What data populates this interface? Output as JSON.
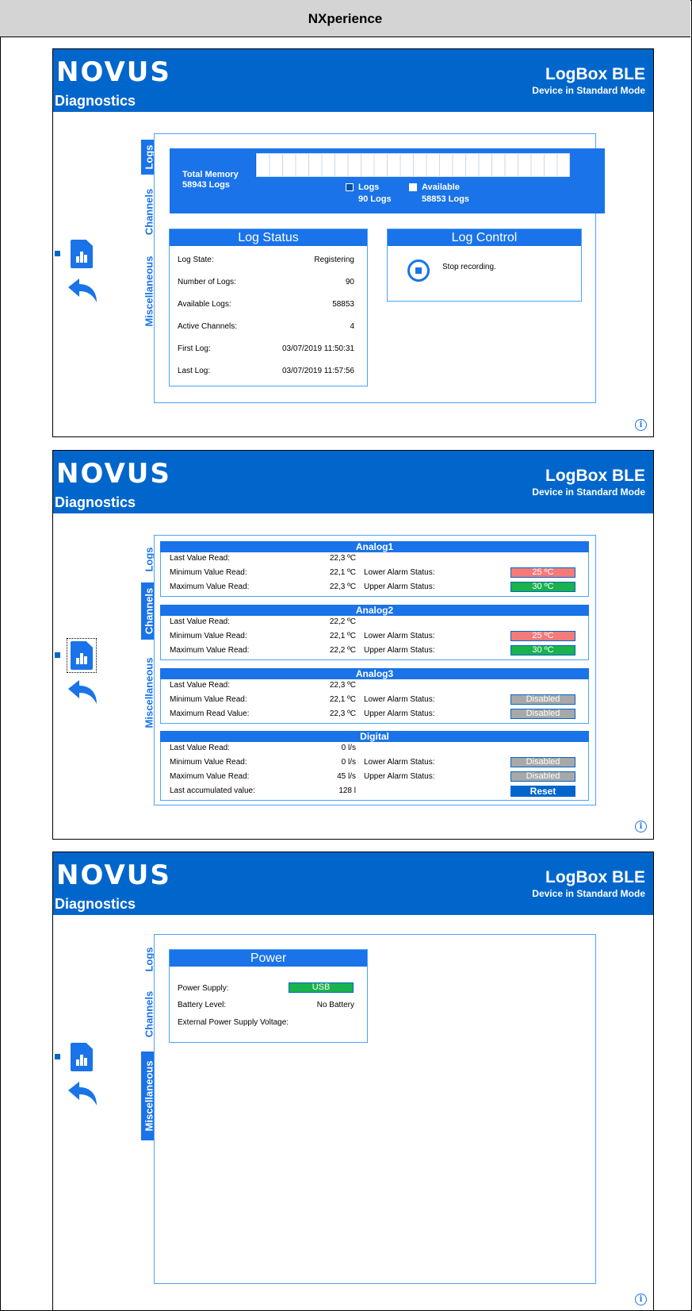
{
  "header": {
    "title": "NXperience"
  },
  "app": {
    "logo": "NOVUS",
    "section": "Diagnostics",
    "device": "LogBox BLE",
    "mode": "Device in Standard Mode"
  },
  "tabs": [
    "Logs",
    "Channels",
    "Miscellaneous"
  ],
  "logs_screen": {
    "memory": {
      "total_label": "Total Memory",
      "total_value": "58943 Logs",
      "logs_label": "Logs",
      "logs_value": "90 Logs",
      "available_label": "Available",
      "available_value": "58853 Logs",
      "used_fraction": 0.0015
    },
    "log_status": {
      "title": "Log Status",
      "rows": [
        {
          "label": "Log State:",
          "value": "Registering"
        },
        {
          "label": "Number of Logs:",
          "value": "90"
        },
        {
          "label": "Available Logs:",
          "value": "58853"
        },
        {
          "label": "Active Channels:",
          "value": "4"
        },
        {
          "label": "First Log:",
          "value": "03/07/2019 11:50:31"
        },
        {
          "label": "Last Log:",
          "value": "03/07/2019 11:57:56"
        }
      ]
    },
    "log_control": {
      "title": "Log Control",
      "stop_label": "Stop recording."
    }
  },
  "channels_screen": {
    "channels": [
      {
        "name": "Analog1",
        "rows": [
          {
            "label": "Last Value Read:",
            "value": "22,3 ºC"
          },
          {
            "label": "Minimum Value Read:",
            "value": "22,1 ºC",
            "alarm_label": "Lower Alarm Status:",
            "alarm_value": "25 ºC",
            "alarm_color": "red"
          },
          {
            "label": "Maximum Value Read:",
            "value": "22,3 ºC",
            "alarm_label": "Upper Alarm Status:",
            "alarm_value": "30 ºC",
            "alarm_color": "green"
          }
        ]
      },
      {
        "name": "Analog2",
        "rows": [
          {
            "label": "Last Value Read:",
            "value": "22,2 ºC"
          },
          {
            "label": "Minimum Value Read:",
            "value": "22,1 ºC",
            "alarm_label": "Lower Alarm Status:",
            "alarm_value": "25 ºC",
            "alarm_color": "red"
          },
          {
            "label": "Maximum Value Read:",
            "value": "22,2 ºC",
            "alarm_label": "Upper Alarm Status:",
            "alarm_value": "30 ºC",
            "alarm_color": "green"
          }
        ]
      },
      {
        "name": "Analog3",
        "rows": [
          {
            "label": "Last Value Read:",
            "value": "22,3 ºC"
          },
          {
            "label": "Minimum Value Read:",
            "value": "22,1 ºC",
            "alarm_label": "Lower Alarm Status:",
            "alarm_value": "Disabled",
            "alarm_color": "grey"
          },
          {
            "label": "Maximum Read Value:",
            "value": "22,3 ºC",
            "alarm_label": "Upper Alarm Status:",
            "alarm_value": "Disabled",
            "alarm_color": "grey"
          }
        ]
      },
      {
        "name": "Digital",
        "rows": [
          {
            "label": "Last Value Read:",
            "value": "0 l/s"
          },
          {
            "label": "Minimum Value Read:",
            "value": "0 l/s",
            "alarm_label": "Lower Alarm Status:",
            "alarm_value": "Disabled",
            "alarm_color": "grey"
          },
          {
            "label": "Maximum Value Read:",
            "value": "45 l/s",
            "alarm_label": "Upper Alarm Status:",
            "alarm_value": "Disabled",
            "alarm_color": "grey"
          },
          {
            "label": "Last accumulated value:",
            "value": "128 l"
          }
        ],
        "reset_label": "Reset"
      }
    ]
  },
  "misc_screen": {
    "power": {
      "title": "Power",
      "supply_label": "Power Supply:",
      "supply_value": "USB",
      "battery_label": "Battery Level:",
      "battery_value": "No Battery",
      "external_label": "External Power Supply Voltage:"
    }
  },
  "colors": {
    "brand_blue": "#0066cc",
    "accent_blue": "#1a73e8",
    "alarm_green": "#19b24b",
    "alarm_red": "#f37b7b",
    "disabled_grey": "#a8a8a8"
  }
}
